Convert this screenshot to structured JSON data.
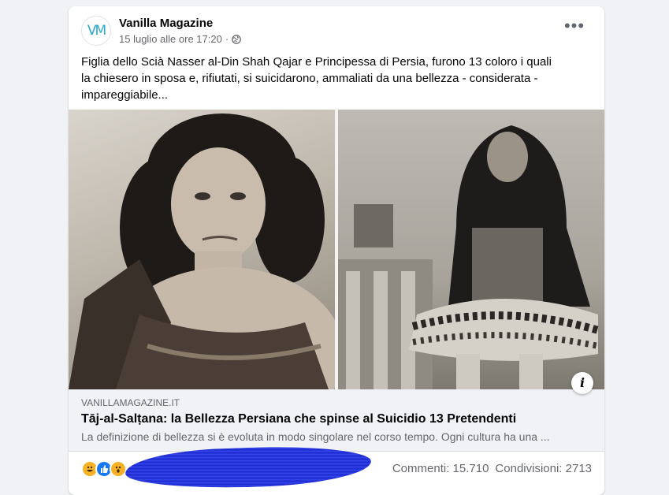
{
  "post": {
    "page_name": "Vanilla Magazine",
    "avatar_text": "VM",
    "timestamp": "15 luglio alle ore 17:20",
    "separator": "·",
    "text": "Figlia dello Scià Nasser al-Din Shah Qajar e Principessa di Persia, furono 13 coloro i quali la chiesero in sposa e, rifiutati, si suicidarono, ammaliati da una bellezza - considerata - impareggiabile..."
  },
  "link": {
    "domain": "VANILLAMAGAZINE.IT",
    "title": "Tāj-al-Salṭana: la Bellezza Persiana che spinse al Suicidio 13 Pretendenti",
    "description": "La definizione di bellezza si è evoluta in modo singolare nel corso tempo. Ogni cultura ha una ..."
  },
  "footer": {
    "comments": "Commenti: 15.710",
    "shares": "Condivisioni: 2713"
  },
  "icons": {
    "more": "more-options-icon",
    "audience": "globe-icon",
    "info": "info-icon",
    "reactions": [
      "haha-icon",
      "like-icon",
      "wow-icon"
    ]
  },
  "colors": {
    "brand": "#2ba6c9",
    "like_blue": "#1877f2",
    "redaction": "#2234d8"
  }
}
